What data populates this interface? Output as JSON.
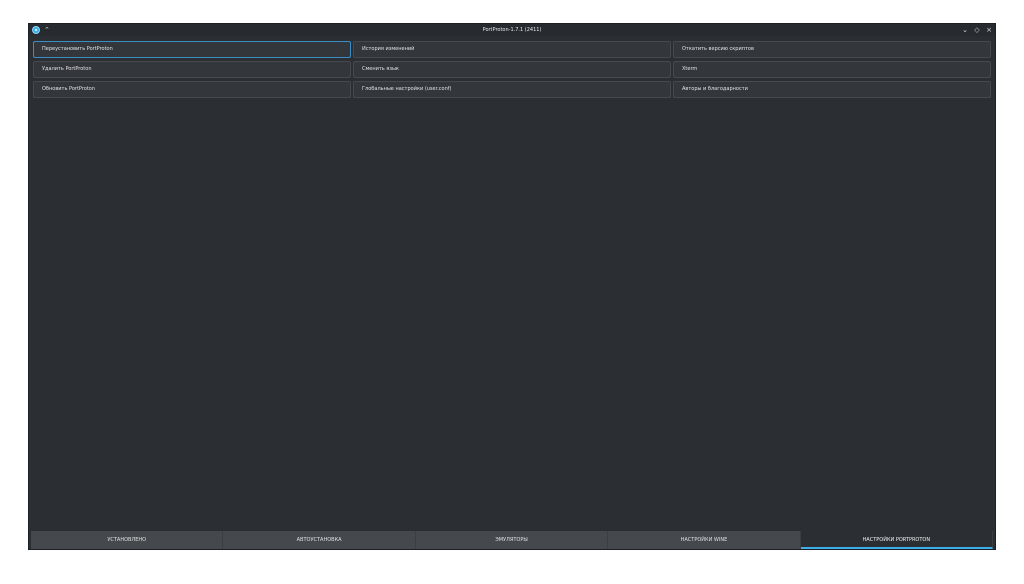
{
  "window": {
    "title": "PortProton-1.7.1 (2411)",
    "controls": {
      "minimize": "⌄",
      "maximize": "◇",
      "close": "×"
    }
  },
  "buttons": [
    {
      "label": "Переустановить PortProton"
    },
    {
      "label": "История изменений"
    },
    {
      "label": "Откатить версию скриптов"
    },
    {
      "label": "Удалить PortProton"
    },
    {
      "label": "Сменить язык"
    },
    {
      "label": "Xterm"
    },
    {
      "label": "Обновить PortProton"
    },
    {
      "label": "Глобальные настройки (user.conf)"
    },
    {
      "label": "Авторы и благодарности"
    }
  ],
  "tabs": [
    {
      "label": "УСТАНОВЛЕНО"
    },
    {
      "label": "АВТОУСТАНОВКА"
    },
    {
      "label": "ЭМУЛЯТОРЫ"
    },
    {
      "label": "НАСТРОЙКИ WINE"
    },
    {
      "label": "НАСТРОЙКИ PORTPROTON"
    }
  ],
  "colors": {
    "background": "#2b2f33",
    "button": "#33373b",
    "tab": "#45494d",
    "accent": "#3daee9"
  }
}
